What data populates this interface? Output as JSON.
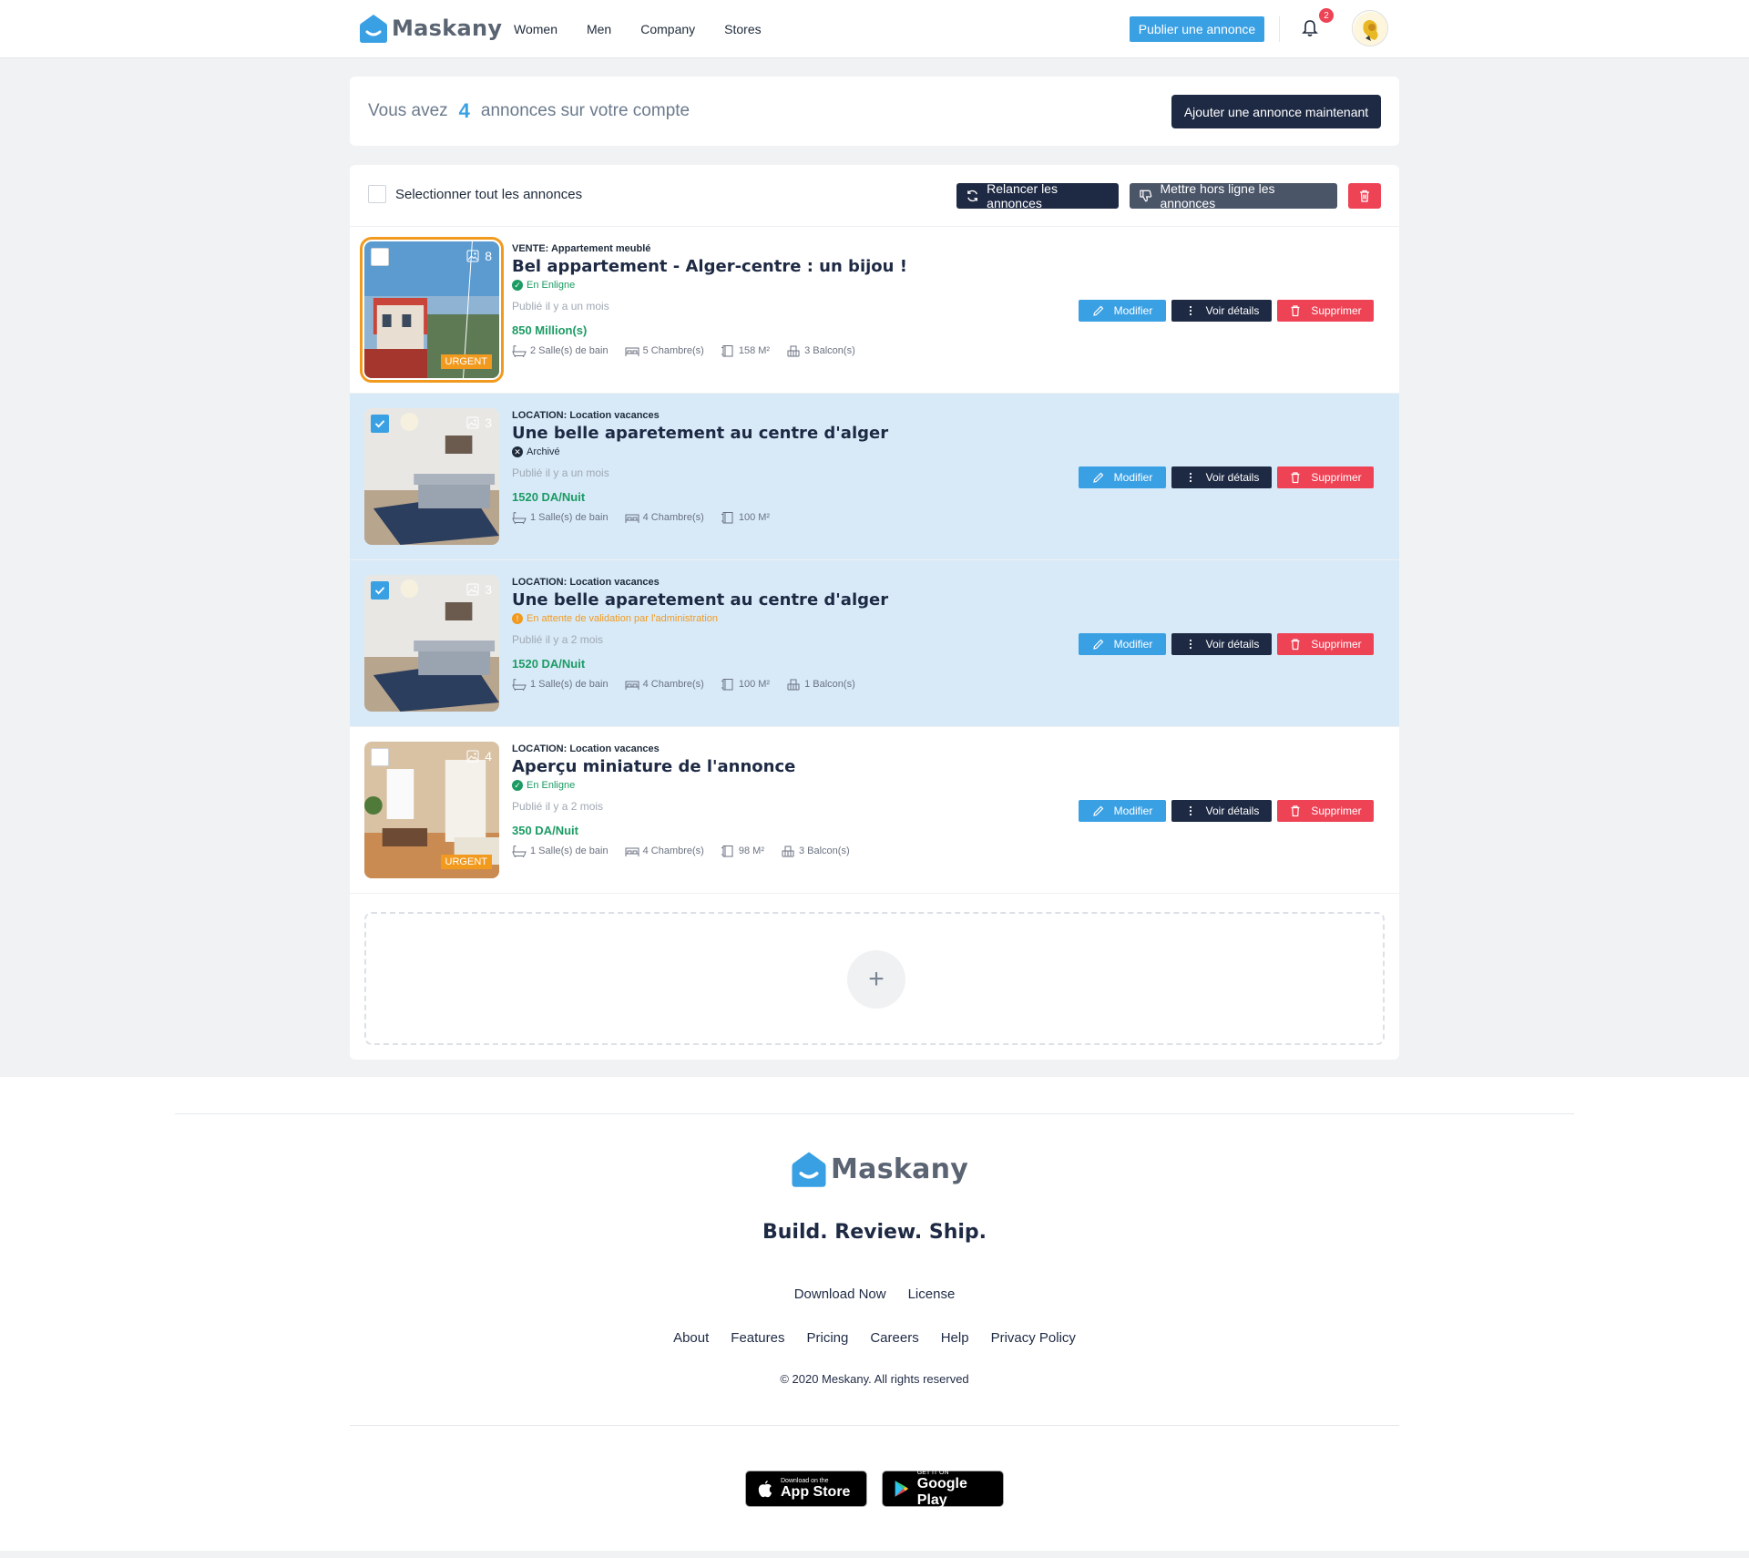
{
  "brand": {
    "name": "Maskany"
  },
  "nav": [
    "Women",
    "Men",
    "Company",
    "Stores"
  ],
  "header": {
    "publish_label": "Publier une annonce",
    "notif_count": "2"
  },
  "summary": {
    "prefix": "Vous avez",
    "count": "4",
    "suffix": "annonces sur votre compte",
    "add_label": "Ajouter une annonce maintenant"
  },
  "toolbar": {
    "select_all": "Selectionner tout les annonces",
    "relaunch": "Relancer les annonces",
    "offline": "Mettre hors ligne les annonces"
  },
  "actions": {
    "edit": "Modifier",
    "details": "Voir détails",
    "delete": "Supprimer"
  },
  "listings": [
    {
      "category": "VENTE: Appartement meublé",
      "title": "Bel appartement - Alger-centre : un bijou !",
      "status": "En Enligne",
      "status_kind": "online",
      "published": "Publié il y a un mois",
      "price": "850 Million(s)",
      "photos": "8",
      "urgent": "URGENT",
      "selected": false,
      "features": [
        "2 Salle(s) de bain",
        "5 Chambre(s)",
        "158 M²",
        "3 Balcon(s)"
      ]
    },
    {
      "category": "LOCATION: Location vacances",
      "title": "Une belle aparetement au centre d'alger",
      "status": "Archivé",
      "status_kind": "archived",
      "published": "Publié il y a un mois",
      "price": "1520 DA/Nuit",
      "photos": "3",
      "urgent": "",
      "selected": true,
      "features": [
        "1 Salle(s) de bain",
        "4 Chambre(s)",
        "100 M²"
      ]
    },
    {
      "category": "LOCATION: Location vacances",
      "title": "Une belle aparetement au centre d'alger",
      "status": "En attente de validation par l'administration",
      "status_kind": "pending",
      "published": "Publié il y a 2 mois",
      "price": "1520 DA/Nuit",
      "photos": "3",
      "urgent": "",
      "selected": true,
      "features": [
        "1 Salle(s) de bain",
        "4 Chambre(s)",
        "100 M²",
        "1 Balcon(s)"
      ]
    },
    {
      "category": "LOCATION: Location vacances",
      "title": "Aperçu miniature de l'annonce",
      "status": "En Enligne",
      "status_kind": "online",
      "published": "Publié il y a 2 mois",
      "price": "350 DA/Nuit",
      "photos": "4",
      "urgent": "URGENT",
      "selected": false,
      "features": [
        "1 Salle(s) de bain",
        "4 Chambre(s)",
        "98 M²",
        "3 Balcon(s)"
      ]
    }
  ],
  "footer": {
    "tagline": "Build. Review. Ship.",
    "links_primary": [
      "Download Now",
      "License"
    ],
    "links_secondary": [
      "About",
      "Features",
      "Pricing",
      "Careers",
      "Help",
      "Privacy Policy"
    ],
    "copyright": "© 2020 Meskany. All rights reserved",
    "appstore": {
      "small": "Download on the",
      "big": "App Store"
    },
    "googleplay": {
      "small": "GET IT ON",
      "big": "Google Play"
    }
  },
  "colors": {
    "accent": "#3aa0e4",
    "dark": "#1e2a44",
    "danger": "#ee4255",
    "urgent": "#f29a1e",
    "price": "#1c9b64",
    "selected_row": "#d8eaf8"
  }
}
